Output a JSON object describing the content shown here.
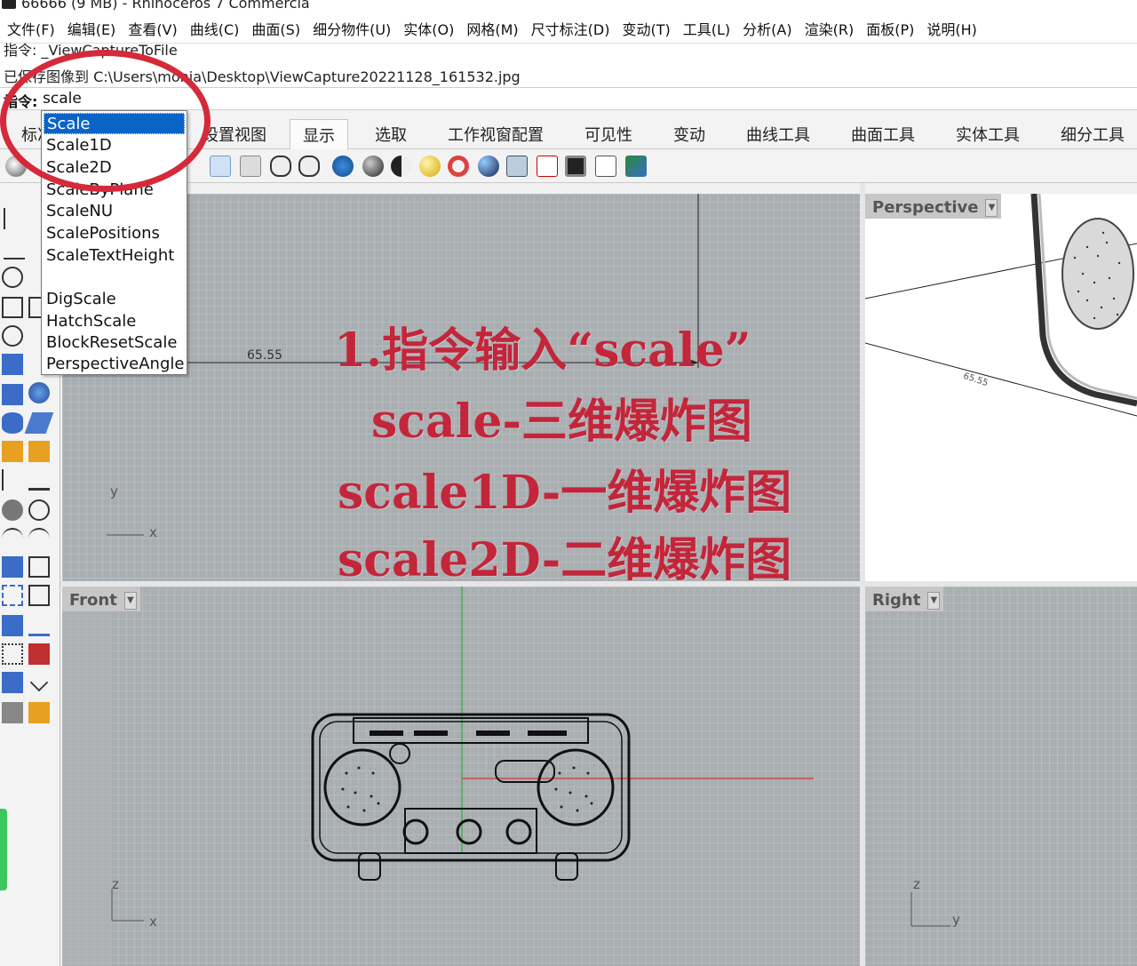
{
  "window": {
    "title": "66666 (9 MB) - Rhinoceros 7 Commercia"
  },
  "menu": [
    "文件(F)",
    "编辑(E)",
    "查看(V)",
    "曲线(C)",
    "曲面(S)",
    "细分物件(U)",
    "实体(O)",
    "网格(M)",
    "尺寸标注(D)",
    "变动(T)",
    "工具(L)",
    "分析(A)",
    "渲染(R)",
    "面板(P)",
    "说明(H)"
  ],
  "history": {
    "line1": "指令: _ViewCaptureToFile",
    "line2": "已保存图像到 C:\\Users\\monia\\Desktop\\ViewCapture20221128_161532.jpg"
  },
  "command": {
    "prompt": "指令:",
    "value": "scale"
  },
  "autocomplete": {
    "options": [
      "Scale",
      "Scale1D",
      "Scale2D",
      "ScaleByPlane",
      "ScaleNU",
      "ScalePositions",
      "ScaleTextHeight",
      "",
      "DigScale",
      "HatchScale",
      "BlockResetScale",
      "PerspectiveAngle"
    ],
    "selected": "Scale"
  },
  "tabs": {
    "items": [
      "标准",
      "设置视图",
      "显示",
      "选取",
      "工作视窗配置",
      "可见性",
      "变动",
      "曲线工具",
      "曲面工具",
      "实体工具",
      "细分工具"
    ],
    "active": "显示"
  },
  "viewports": {
    "top": {
      "dimension": "65.55",
      "axis_x": "x",
      "axis_y": "y"
    },
    "perspective": {
      "label": "Perspective",
      "dimension": "65.55"
    },
    "front": {
      "label": "Front",
      "axis_x": "x",
      "axis_y": "z"
    },
    "right": {
      "label": "Right",
      "axis_x": "y",
      "axis_y": "z"
    }
  },
  "annotation": {
    "line1": "1.指令输入“scale”",
    "line2": "scale-三维爆炸图",
    "line3": "scale1D-一维爆炸图",
    "line4": "scale2D-二维爆炸图",
    "color": "#c3263a"
  },
  "colors": {
    "highlight": "#0a64c8",
    "grid": "#a9aeb1",
    "circle": "#d42a3a"
  }
}
